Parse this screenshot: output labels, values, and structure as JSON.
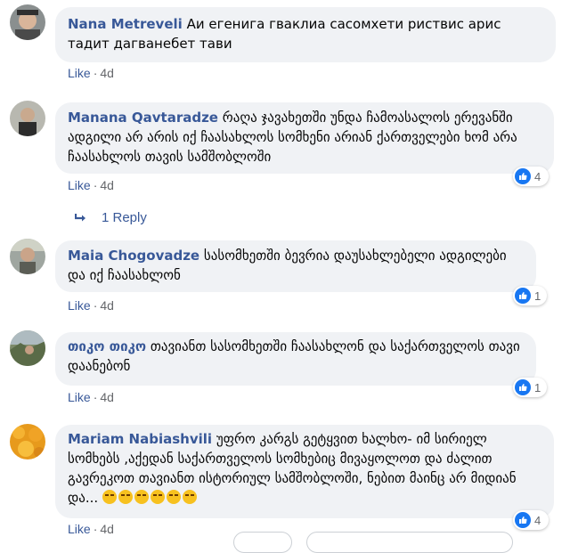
{
  "comments": [
    {
      "author": "Nana Metreveli",
      "text": "Аи егенига гваклиа сасомхети риствис арис тадит дагванебет тави",
      "like": "Like",
      "time": "4d"
    },
    {
      "author": "Manana Qavtaradze",
      "text": "რაღა ჯავახეთში უნდა ჩამოასალოს ერევანში ადგილი არ არის იქ ჩაასახლოს სომხენი არიან ქართველები ხომ არა ჩაასახლოს თავის სამშობლოში",
      "like": "Like",
      "time": "4d",
      "reaction_count": "4",
      "replies": "1 Reply"
    },
    {
      "author": "Maia Chogovadze",
      "text": "სასომხეთში ბევრია დაუსახლებელი ადგილები და იქ ჩაასახლონ",
      "like": "Like",
      "time": "4d",
      "reaction_count": "1"
    },
    {
      "author": "თიკო თიკო",
      "text": "თავიანთ სასომხეთში ჩაასახლონ და საქართველოს თავი დაანებონ",
      "like": "Like",
      "time": "4d",
      "reaction_count": "1"
    },
    {
      "author": "Mariam Nabiashvili",
      "text": "უფრო კარგს გეტყვით ხალხო- იმ სირიელ სომხებს ,აქედან საქართველოს სომხებიც მივაყოლოთ და ძალით გავრეკოთ თავიანთ ისტორიულ სამშობლოში, ნებით მაინც არ მიდიან და...",
      "like": "Like",
      "time": "4d",
      "reaction_count": "4",
      "emoji_count": 6
    }
  ],
  "icons": {
    "like_reaction": "thumbs-up-icon",
    "reply_arrow": "reply-arrow-icon",
    "emoji": "rolling-on-floor-laughing-emoji"
  },
  "colors": {
    "name": "#385898",
    "bubble": "#f0f2f5",
    "like_blue": "#1877f2",
    "meta_gray": "#65676b"
  }
}
